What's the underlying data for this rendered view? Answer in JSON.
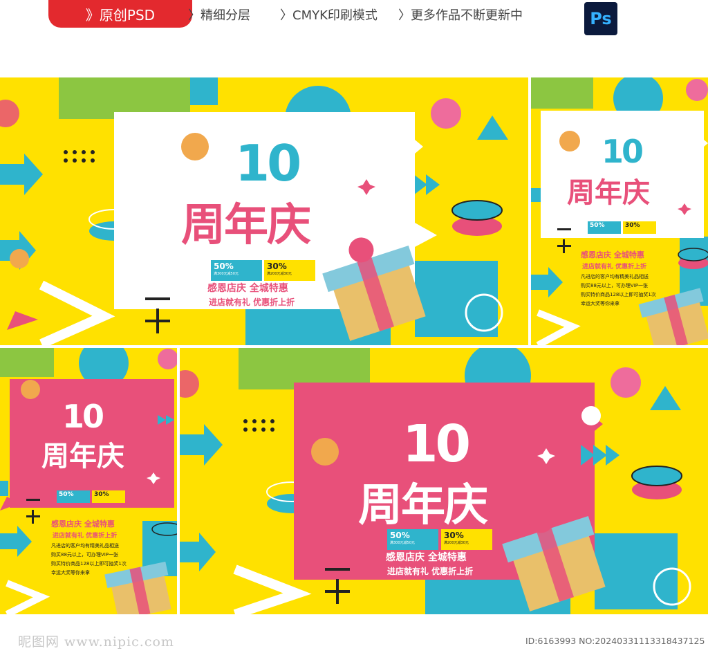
{
  "header": {
    "tab_label": "》原创PSD",
    "crumbs": [
      "〉精细分层",
      "〉CMYK印刷模式",
      "〉更多作品不断更新中"
    ],
    "ps_label": "Ps"
  },
  "poster": {
    "number": "10",
    "title": "周年庆",
    "badge1_pct": "50%",
    "badge1_sub": "满300元减50元",
    "badge2_pct": "30%",
    "badge2_sub": "满200元减30元",
    "slogan1": "感恩店庆 全城特惠",
    "slogan2": "进店就有礼 优惠折上折",
    "rules": [
      "凡进店的客户均有精美礼品相送",
      "购买88元以上，可办理VIP一张",
      "购买特价商品128以上即可抽奖1次",
      "幸运大奖等你来拿"
    ]
  },
  "footer": {
    "watermark": "昵图网 www.nipic.com",
    "id_text": "ID:6163993 NO:20240331113318437125"
  },
  "colors": {
    "yellow": "#ffe100",
    "pink": "#e8507a",
    "teal": "#2fb4cc",
    "green": "#8cc641",
    "red": "#e3292e"
  }
}
